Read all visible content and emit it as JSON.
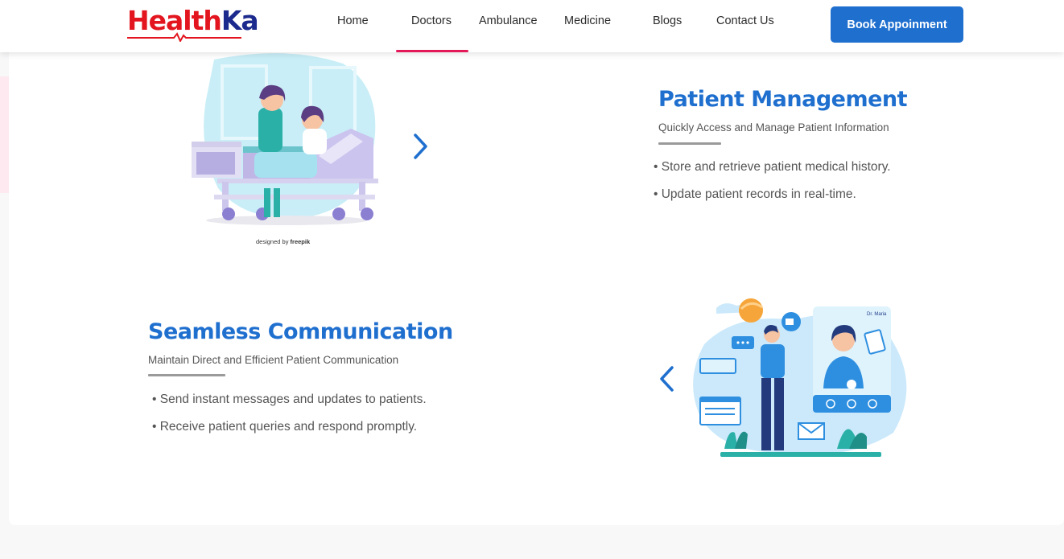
{
  "brand": {
    "logo_part1": "Health",
    "logo_part2": "Ka",
    "color_red": "#e3151f",
    "color_blue": "#1b2a8c"
  },
  "nav": {
    "items": [
      {
        "label": "Home"
      },
      {
        "label": "Doctors",
        "active": true
      },
      {
        "label": "Ambulance"
      },
      {
        "label": "Medicine"
      },
      {
        "label": "Blogs"
      },
      {
        "label": "Contact Us"
      }
    ],
    "cta_label": "Book Appoinment",
    "accent": "#1f6fcf",
    "active_underline": "#e3195a"
  },
  "features": [
    {
      "title": "Patient Management",
      "subtitle": "Quickly Access and Manage Patient Information",
      "bullets": [
        "• Store and retrieve patient medical history.",
        "• Update patient records in real-time."
      ],
      "illustration": "hospital-bed-nurse-illustration",
      "credit_prefix": "designed by",
      "credit_brand": "freepik",
      "nav_icon": "chevron-right-icon"
    },
    {
      "title": "Seamless Communication",
      "subtitle": "Maintain Direct and Efficient Patient Communication",
      "bullets": [
        "• Send instant messages and updates to patients.",
        "• Receive patient queries and respond promptly."
      ],
      "illustration": "video-call-doctor-illustration",
      "phone_doctor_label": "Dr. Maria",
      "nav_icon": "chevron-left-icon"
    }
  ]
}
